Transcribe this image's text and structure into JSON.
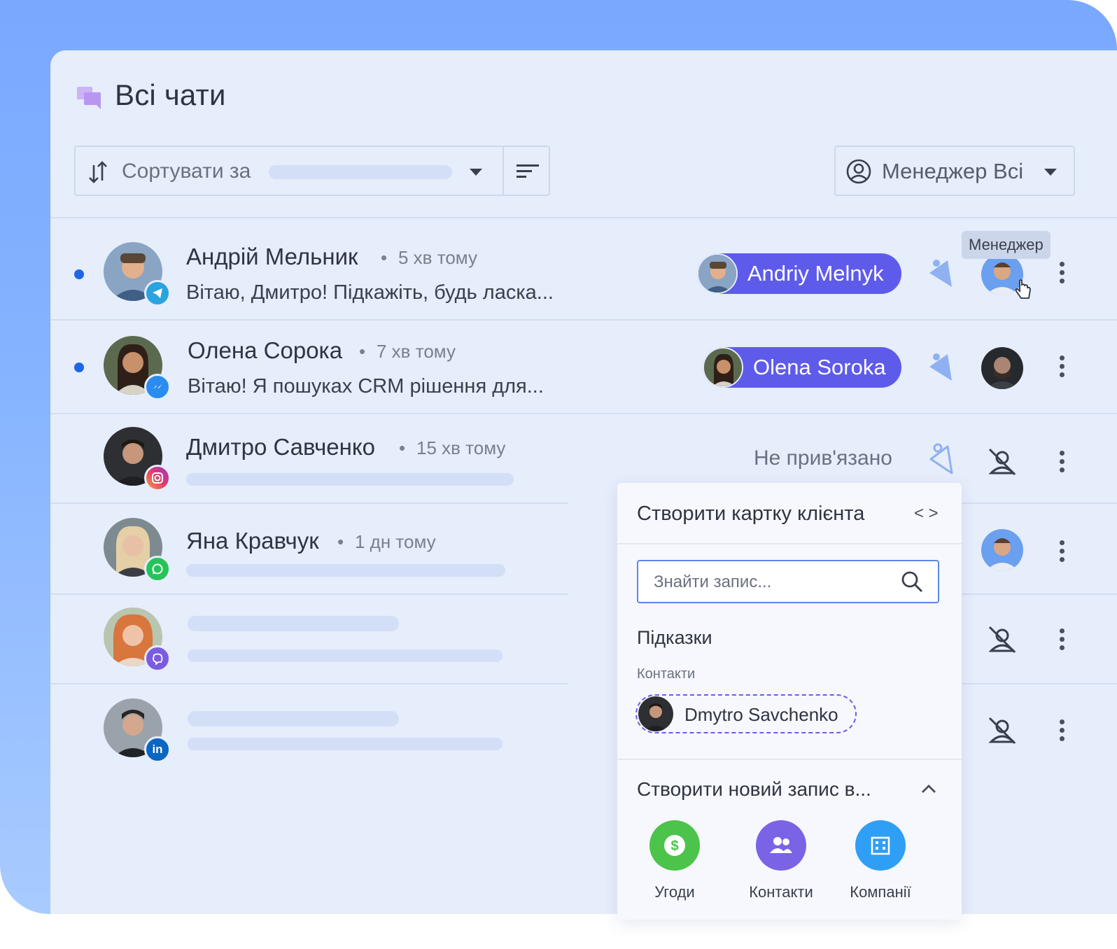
{
  "page": {
    "title": "Всі чати"
  },
  "toolbar": {
    "sort_label": "Сортувати за",
    "manager_label": "Менеджер Всі"
  },
  "tooltip": "Менеджер",
  "chats": [
    {
      "name": "Андрій Мельник",
      "time": "5 хв тому",
      "preview": "Вітаю, Дмитро! Підкажіть, будь ласка...",
      "channel": "telegram",
      "assigned": "Andriy Melnyk",
      "unread": true
    },
    {
      "name": "Олена Сорока",
      "time": "7 хв тому",
      "preview": "Вітаю! Я пошуках CRM рішення для...",
      "channel": "messenger",
      "assigned": "Olena Soroka",
      "unread": true
    },
    {
      "name": "Дмитро Савченко",
      "time": "15 хв тому",
      "preview": "",
      "channel": "instagram",
      "assigned": "Не прив'язано",
      "unread": false
    },
    {
      "name": "Яна Кравчук",
      "time": "1 дн тому",
      "preview": "",
      "channel": "whatsapp",
      "assigned": "",
      "unread": false
    },
    {
      "name": "",
      "time": "",
      "preview": "",
      "channel": "viber",
      "assigned": "",
      "unread": false
    },
    {
      "name": "",
      "time": "",
      "preview": "",
      "channel": "linkedin",
      "assigned": "",
      "unread": false
    }
  ],
  "popup": {
    "title": "Створити картку клієнта",
    "code_symbol": "< >",
    "search_placeholder": "Знайти запис...",
    "hints_title": "Підказки",
    "contacts_label": "Контакти",
    "suggestion": "Dmytro Savchenko",
    "create_title": "Створити новий запис в...",
    "buttons": [
      {
        "label": "Угоди",
        "color": "#4cc34a",
        "icon": "dollar-icon"
      },
      {
        "label": "Контакти",
        "color": "#7b63e6",
        "icon": "people-icon"
      },
      {
        "label": "Компанії",
        "color": "#2f9ff5",
        "icon": "building-icon"
      }
    ]
  },
  "colors": {
    "accent": "#5f5bea",
    "unread": "#1e66e8",
    "panel_bg": "#e6edfb",
    "frame_bg": "#7aa8ff"
  }
}
